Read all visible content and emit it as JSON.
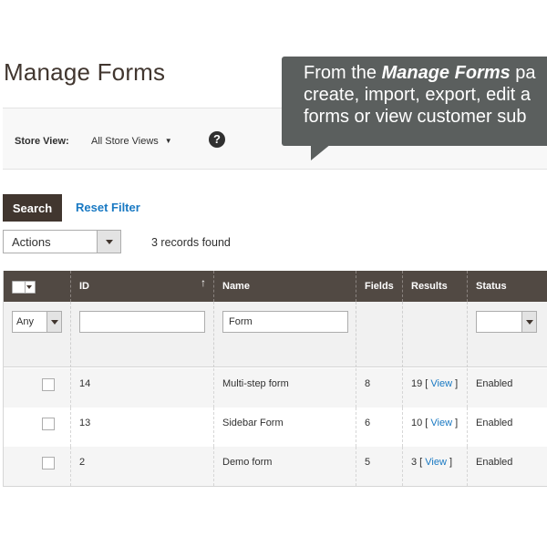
{
  "page": {
    "title": "Manage Forms"
  },
  "store_view": {
    "label": "Store View:",
    "selected": "All Store Views",
    "help": "?"
  },
  "tooltip": {
    "line1_prefix": "From the ",
    "line1_emphasis": "Manage Forms",
    "line1_suffix": " pa",
    "line2": "create, import, export, edit a",
    "line3": "forms or view customer sub"
  },
  "toolbar": {
    "search_label": "Search",
    "reset_label": "Reset Filter"
  },
  "actions": {
    "selected": "Actions",
    "records_found": "3 records found"
  },
  "grid": {
    "columns": [
      {
        "key": "select",
        "label": ""
      },
      {
        "key": "id",
        "label": "ID",
        "sort": "↑"
      },
      {
        "key": "name",
        "label": "Name"
      },
      {
        "key": "fields",
        "label": "Fields"
      },
      {
        "key": "results",
        "label": "Results"
      },
      {
        "key": "status",
        "label": "Status"
      }
    ],
    "filters": {
      "select": "Any",
      "id": "",
      "name": "Form",
      "status": ""
    },
    "rows": [
      {
        "id": "14",
        "name": "Multi-step form",
        "fields": "8",
        "results_count": "19",
        "view_label": "View",
        "status": "Enabled"
      },
      {
        "id": "13",
        "name": "Sidebar Form",
        "fields": "6",
        "results_count": "10",
        "view_label": "View",
        "status": "Enabled"
      },
      {
        "id": "2",
        "name": "Demo form",
        "fields": "5",
        "results_count": "3",
        "view_label": "View",
        "status": "Enabled"
      }
    ]
  },
  "colors": {
    "header_bg": "#514943",
    "button_bg": "#41362f",
    "link": "#1979c3",
    "tooltip_bg": "#5b5f5e"
  }
}
